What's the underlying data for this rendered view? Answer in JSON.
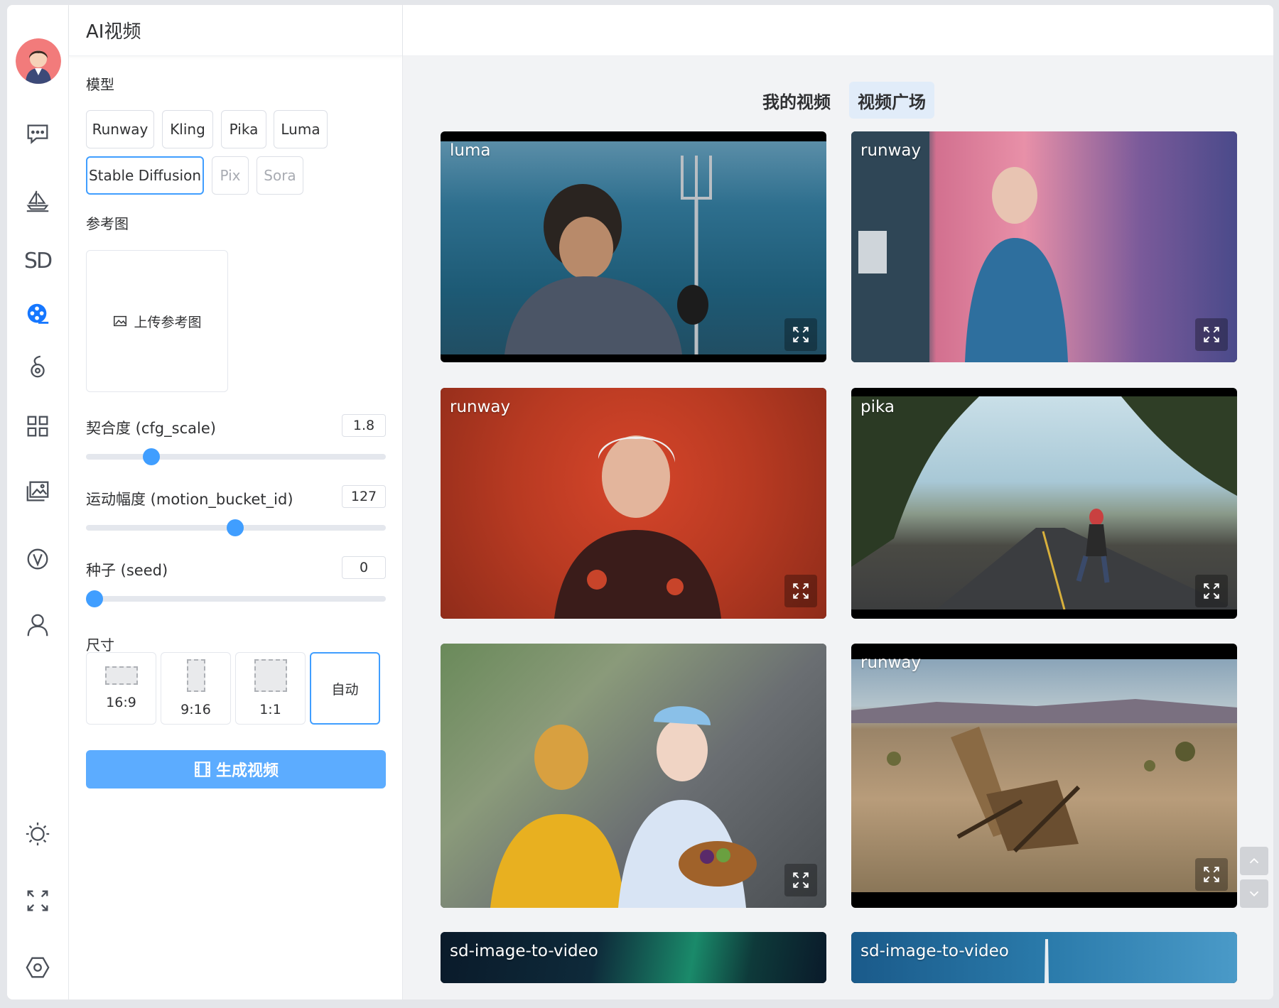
{
  "panel": {
    "title": "AI视频",
    "model_label": "模型",
    "models": [
      "Runway",
      "Kling",
      "Pika",
      "Luma",
      "Stable Diffusion",
      "Pix",
      "Sora"
    ],
    "selected_model": "Stable Diffusion",
    "ref_label": "参考图",
    "upload_label": "上传参考图",
    "cfg": {
      "label": "契合度 (cfg_scale)",
      "value": "1.8",
      "fraction": 0.2
    },
    "motion": {
      "label": "运动幅度 (motion_bucket_id)",
      "value": "127",
      "fraction": 0.497
    },
    "seed": {
      "label": "种子 (seed)",
      "value": "0",
      "fraction": 0.0
    },
    "size_label": "尺寸",
    "sizes": [
      "16:9",
      "9:16",
      "1:1",
      "自动"
    ],
    "selected_size": "自动",
    "generate_label": "生成视频"
  },
  "main": {
    "tabs": [
      "我的视频",
      "视频广场"
    ],
    "active_tab": "视频广场",
    "cards": [
      {
        "tag": "luma"
      },
      {
        "tag": "runway"
      },
      {
        "tag": "runway"
      },
      {
        "tag": "pika"
      },
      {
        "tag": ""
      },
      {
        "tag": "runway"
      },
      {
        "tag": "sd-image-to-video"
      },
      {
        "tag": "sd-image-to-video"
      }
    ]
  },
  "nav_icons": [
    "avatar",
    "chat-icon",
    "ship-icon",
    "sd-icon",
    "video-icon",
    "music-icon",
    "apps-icon",
    "gallery-icon",
    "v-icon",
    "user-icon",
    "theme-icon",
    "fullscreen-icon",
    "settings-icon"
  ],
  "colors": {
    "accent": "#409eff",
    "tab_active_bg": "#e1ecf9"
  }
}
